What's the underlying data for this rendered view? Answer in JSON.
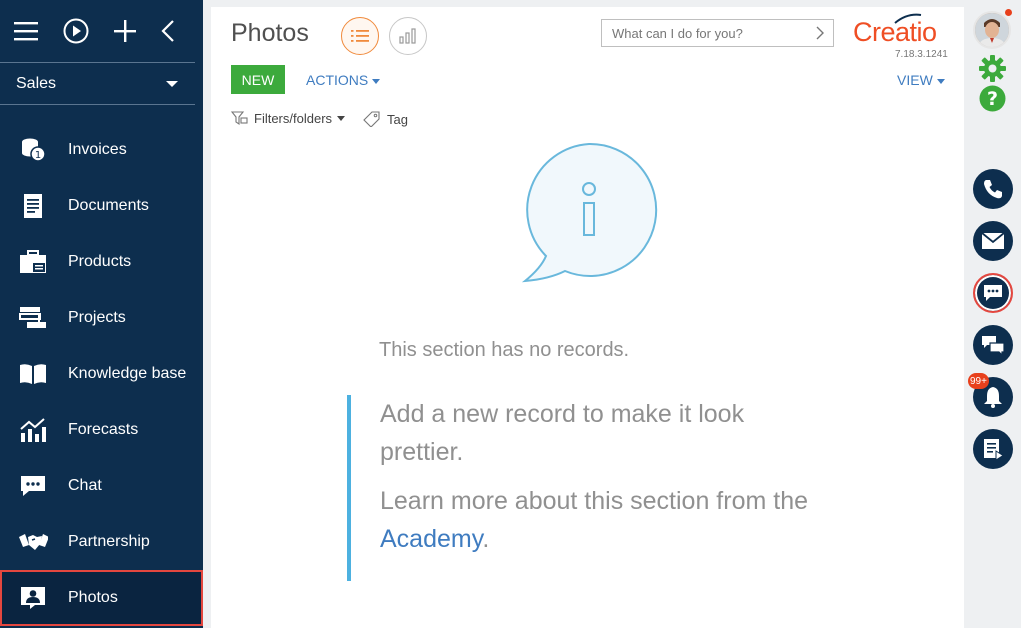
{
  "app": {
    "workspace": "Sales"
  },
  "sidebar": {
    "items": [
      {
        "label": "Invoices",
        "icon": "invoices-icon"
      },
      {
        "label": "Documents",
        "icon": "documents-icon"
      },
      {
        "label": "Products",
        "icon": "products-icon"
      },
      {
        "label": "Projects",
        "icon": "projects-icon"
      },
      {
        "label": "Knowledge base",
        "icon": "book-icon"
      },
      {
        "label": "Forecasts",
        "icon": "forecasts-icon"
      },
      {
        "label": "Chat",
        "icon": "chat-icon"
      },
      {
        "label": "Partnership",
        "icon": "handshake-icon"
      },
      {
        "label": "Photos",
        "icon": "photo-icon",
        "active": true
      }
    ]
  },
  "header": {
    "title": "Photos",
    "search_placeholder": "What can I do for you?",
    "brand": "Creatio",
    "version": "7.18.3.1241"
  },
  "toolbar": {
    "new_label": "NEW",
    "actions_label": "ACTIONS",
    "view_label": "VIEW",
    "filters_label": "Filters/folders",
    "tag_label": "Tag"
  },
  "empty": {
    "message": "This section has no records.",
    "hint1": "Add a new record to make it look prettier.",
    "hint2_prefix": "Learn more about this section from the ",
    "hint2_link": "Academy",
    "hint2_suffix": "."
  },
  "rightpanel": {
    "notifications_badge": "99+"
  },
  "colors": {
    "sidebar": "#0d2e4e",
    "accent": "#ef4e24",
    "new_button": "#3caa3c",
    "link": "#3f7cc0"
  }
}
